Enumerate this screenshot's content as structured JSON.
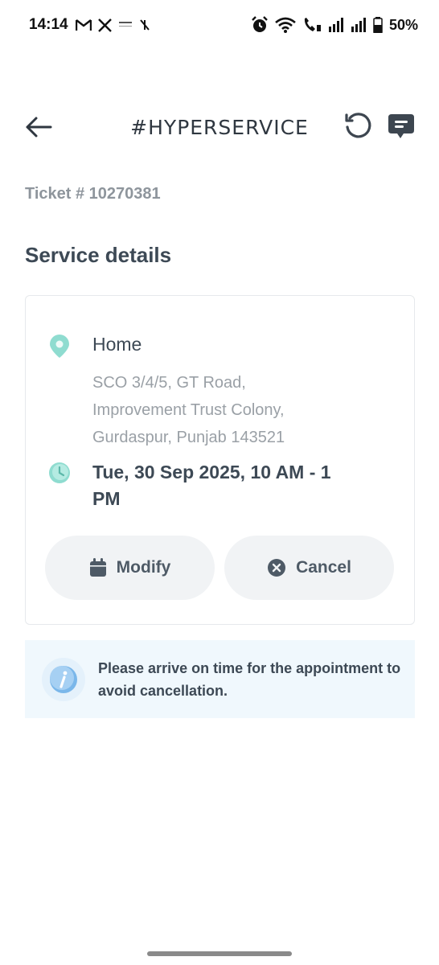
{
  "status_bar": {
    "time": "14:14",
    "battery": "50%",
    "left_icons": [
      "gmail-icon",
      "x-icon",
      "news-icon",
      "muted-icon"
    ],
    "right_icons": [
      "alarm-icon",
      "wifi-icon",
      "wifi-calling-icon",
      "signal-icon",
      "signal-icon",
      "battery-icon"
    ]
  },
  "header": {
    "title": "#HYPERSERVICE"
  },
  "ticket": {
    "label": "Ticket # 10270381"
  },
  "section": {
    "title": "Service details"
  },
  "service": {
    "place": "Home",
    "address_lines": [
      "SCO 3/4/5, GT Road,",
      "Improvement Trust Colony,",
      "Gurdaspur, Punjab 143521"
    ],
    "slot": "Tue, 30 Sep 2025, 10 AM - 1 PM"
  },
  "actions": {
    "modify_label": "Modify",
    "cancel_label": "Cancel"
  },
  "notice": {
    "text": "Please arrive on time for the appointment to avoid cancellation."
  },
  "colors": {
    "accent_teal": "#8fdcd0",
    "info_bg": "#f0f8fd",
    "info_icon": "#7ab7ea",
    "button_bg": "#f1f3f5"
  }
}
